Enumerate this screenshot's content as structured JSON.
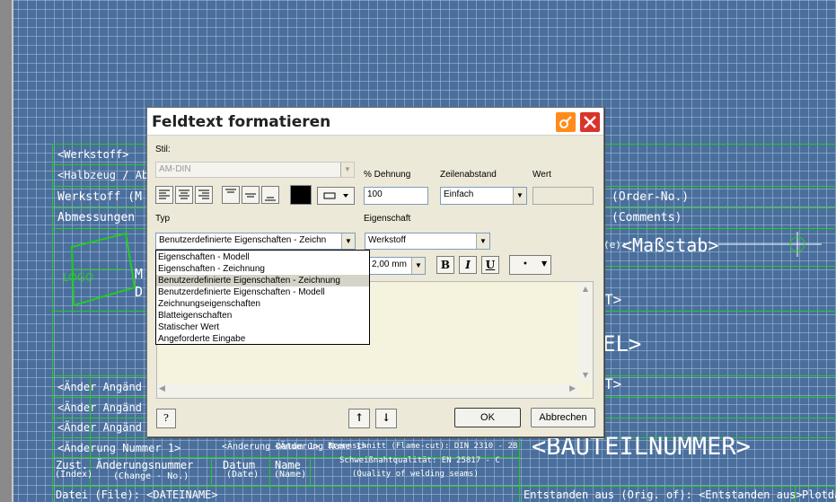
{
  "drawing": {
    "rows": {
      "werkstoff": "<Werkstoff>",
      "halbzeug": "<Halbzeug / Ab",
      "werkstoff_material": "Werkstoff (M",
      "abmessungen": "Abmessungen",
      "order_no": "(Order-No.)",
      "comments": "(Comments)",
      "masstab": "<Maßstab>",
      "masstab_prefix": "(e):",
      "m_letter": "M",
      "d_letter": "D",
      "part_t1": "T>",
      "part_el": "EL>",
      "part_t2": "T>",
      "change1": "<Änder Angänd",
      "change2": "<Änder Angänd",
      "change3": "<Änder Angänd",
      "change_bottom": "<Änderung Nummer 1>",
      "change_date": "<Änderung Datum 1>",
      "change_name": "<Änderung Name 1>",
      "flame_cut": "Brennschnitt (Flame-cut): DIN 2310 - 2B",
      "weld": "Schweißnahtqualität: EN 25817 - C",
      "weld_en": "(Quality of welding seams)",
      "bauteilnummer": "<BAUTEILNUMMER>",
      "zust": "Zust.",
      "index": "(Index)",
      "aenderungsnummer": "Änderungsnummer",
      "change_no": "(Change - No.)",
      "datum": "Datum",
      "date": "(Date)",
      "name": "Name",
      "name_en": "(Name)",
      "datei": "Datei (File): <DATEINAME>",
      "entstanden": "Entstanden aus (Orig. of): <Entstanden aus>",
      "plotdat": "Plotda"
    }
  },
  "dialog": {
    "title": "Feldtext formatieren",
    "stil_label": "Stil:",
    "stil_value": "AM-DIN",
    "dehnung_label": "% Dehnung",
    "dehnung_value": "100",
    "zeilenabstand_label": "Zeilenabstand",
    "zeilenabstand_value": "Einfach",
    "wert_label": "Wert",
    "wert_value": "",
    "typ_label": "Typ",
    "typ_value": "Benutzerdefinierte Eigenschaften - Zeichn",
    "eigenschaft_label": "Eigenschaft",
    "eigenschaft_value": "Werkstoff",
    "font_size_value": "2,00 mm",
    "bold": "B",
    "italic": "I",
    "underline": "U",
    "bullet": "•",
    "ok": "OK",
    "cancel": "Abbrechen",
    "help": "?",
    "typ_options": [
      "Eigenschaften - Modell",
      "Eigenschaften - Zeichnung",
      "Benutzerdefinierte Eigenschaften - Zeichnung",
      "Benutzerdefinierte Eigenschaften - Modell",
      "Zeichnungseigenschaften",
      "Blatteigenschaften",
      "Statischer Wert",
      "Angeforderte Eingabe"
    ],
    "typ_selected_index": 2,
    "colors": {
      "accent_orange": "#ff8c1a",
      "close_red": "#d9342b",
      "color_swatch": "#000000"
    }
  }
}
